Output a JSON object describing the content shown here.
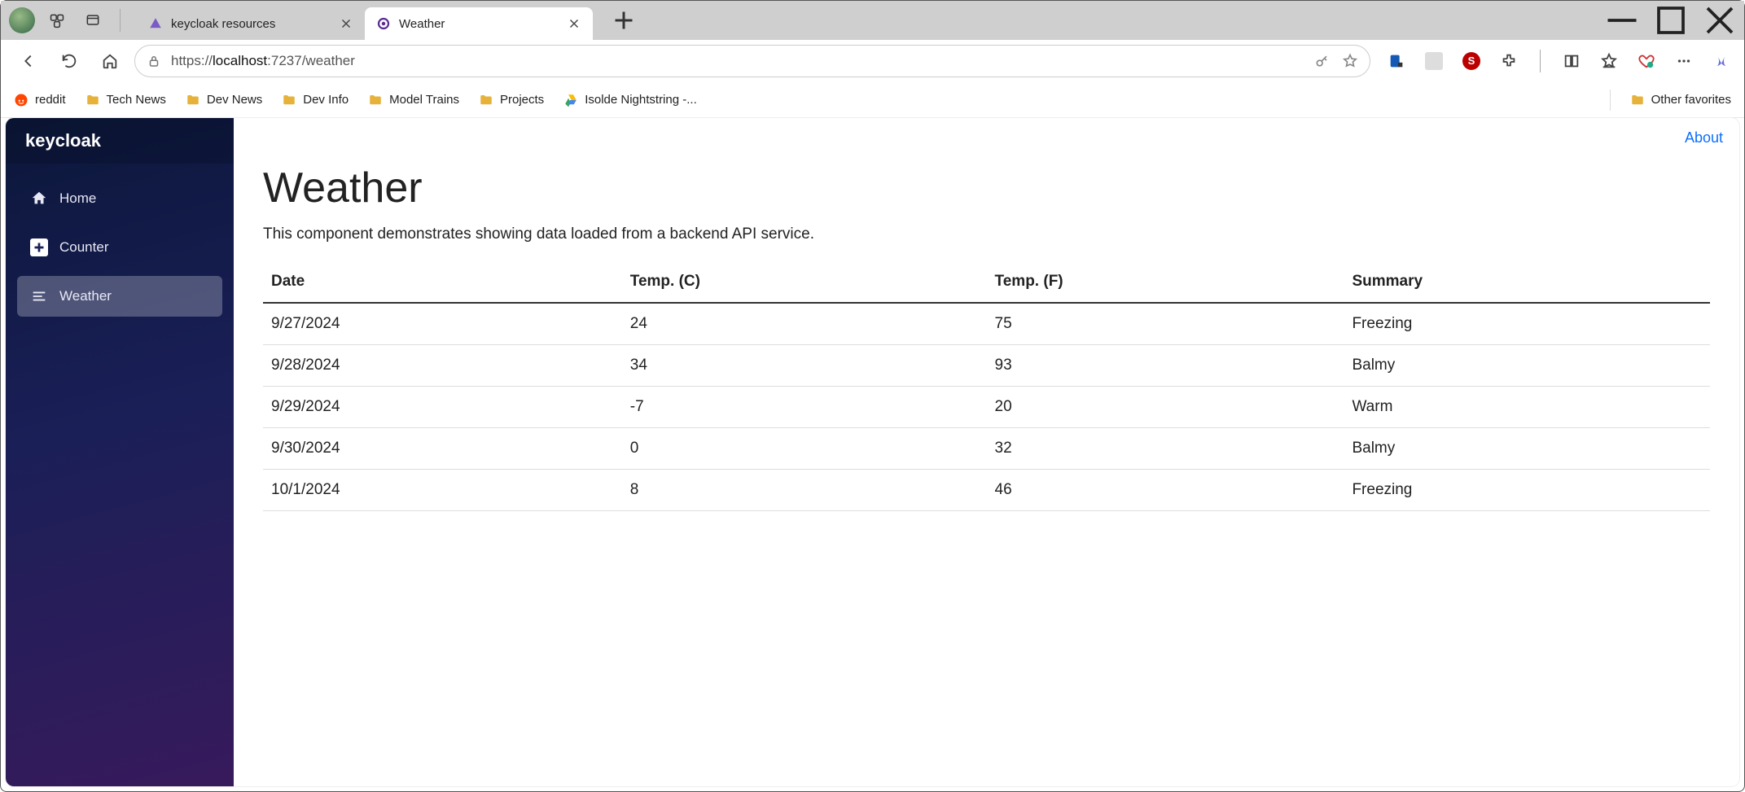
{
  "browser": {
    "tabs": [
      {
        "label": "keycloak resources",
        "active": false
      },
      {
        "label": "Weather",
        "active": true
      }
    ],
    "url_prefix": "https://",
    "url_host": "localhost",
    "url_port": ":7237",
    "url_path": "/weather",
    "bookmarks": [
      {
        "label": "reddit",
        "kind": "reddit"
      },
      {
        "label": "Tech News",
        "kind": "folder"
      },
      {
        "label": "Dev News",
        "kind": "folder"
      },
      {
        "label": "Dev Info",
        "kind": "folder"
      },
      {
        "label": "Model Trains",
        "kind": "folder"
      },
      {
        "label": "Projects",
        "kind": "folder"
      },
      {
        "label": "Isolde Nightstring -...",
        "kind": "drive"
      }
    ],
    "other_favorites": "Other favorites"
  },
  "sidebar": {
    "brand": "keycloak",
    "items": [
      {
        "label": "Home"
      },
      {
        "label": "Counter"
      },
      {
        "label": "Weather"
      }
    ]
  },
  "topbar": {
    "about": "About"
  },
  "page": {
    "title": "Weather",
    "lead": "This component demonstrates showing data loaded from a backend API service."
  },
  "table": {
    "headers": {
      "date": "Date",
      "tc": "Temp. (C)",
      "tf": "Temp. (F)",
      "summary": "Summary"
    },
    "rows": [
      {
        "date": "9/27/2024",
        "tc": "24",
        "tf": "75",
        "summary": "Freezing"
      },
      {
        "date": "9/28/2024",
        "tc": "34",
        "tf": "93",
        "summary": "Balmy"
      },
      {
        "date": "9/29/2024",
        "tc": "-7",
        "tf": "20",
        "summary": "Warm"
      },
      {
        "date": "9/30/2024",
        "tc": "0",
        "tf": "32",
        "summary": "Balmy"
      },
      {
        "date": "10/1/2024",
        "tc": "8",
        "tf": "46",
        "summary": "Freezing"
      }
    ]
  }
}
